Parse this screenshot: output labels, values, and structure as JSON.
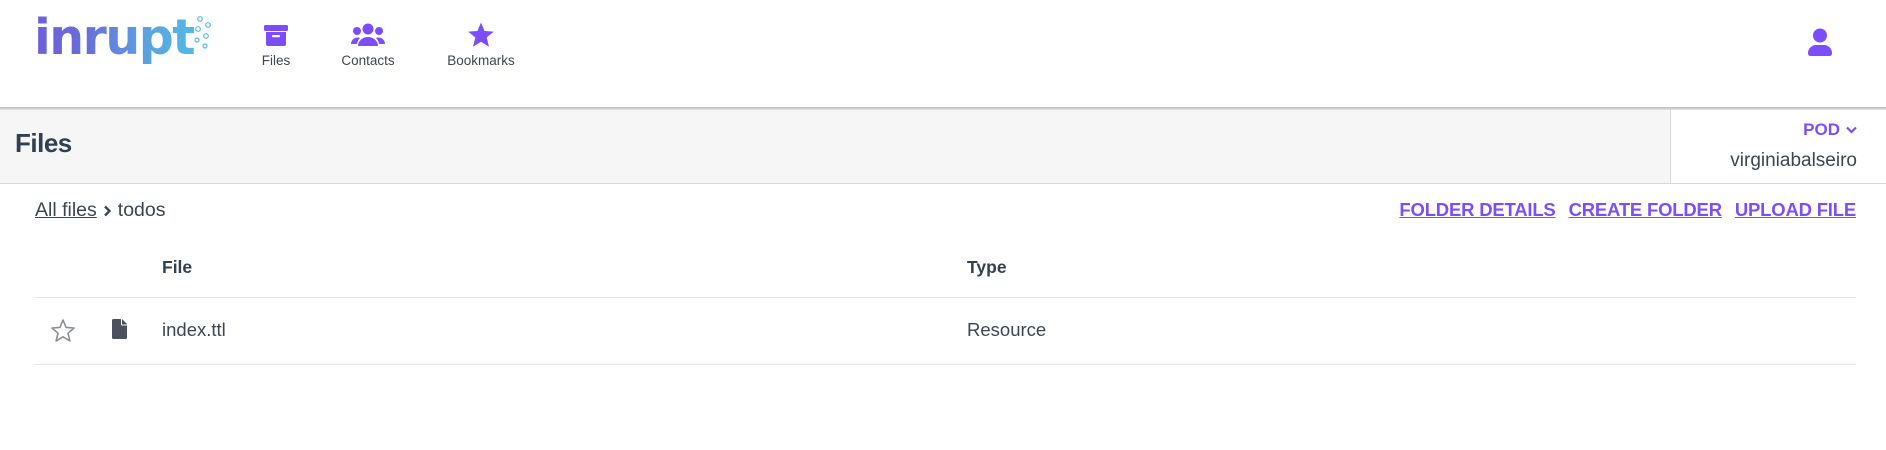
{
  "brand": {
    "logo_text": "inrupt"
  },
  "nav": {
    "items": [
      {
        "label": "Files",
        "icon": "archive-box-icon"
      },
      {
        "label": "Contacts",
        "icon": "users-icon"
      },
      {
        "label": "Bookmarks",
        "icon": "star-icon"
      }
    ],
    "user_icon": "user-icon"
  },
  "header": {
    "title": "Files",
    "pod_label": "POD",
    "pod_name": "virginiabalseiro"
  },
  "breadcrumb": {
    "root": "All files",
    "separator_icon": "chevron-right-icon",
    "current": "todos"
  },
  "actions": {
    "folder_details": "FOLDER DETAILS",
    "create_folder": "CREATE FOLDER",
    "upload_file": "UPLOAD FILE"
  },
  "table": {
    "columns": [
      "File",
      "Type"
    ],
    "rows": [
      {
        "name": "index.ttl",
        "type": "Resource",
        "bookmarked": false
      }
    ]
  },
  "colors": {
    "accent": "#7c4dff",
    "text": "#33404f",
    "header_bg": "#f6f6f6"
  }
}
